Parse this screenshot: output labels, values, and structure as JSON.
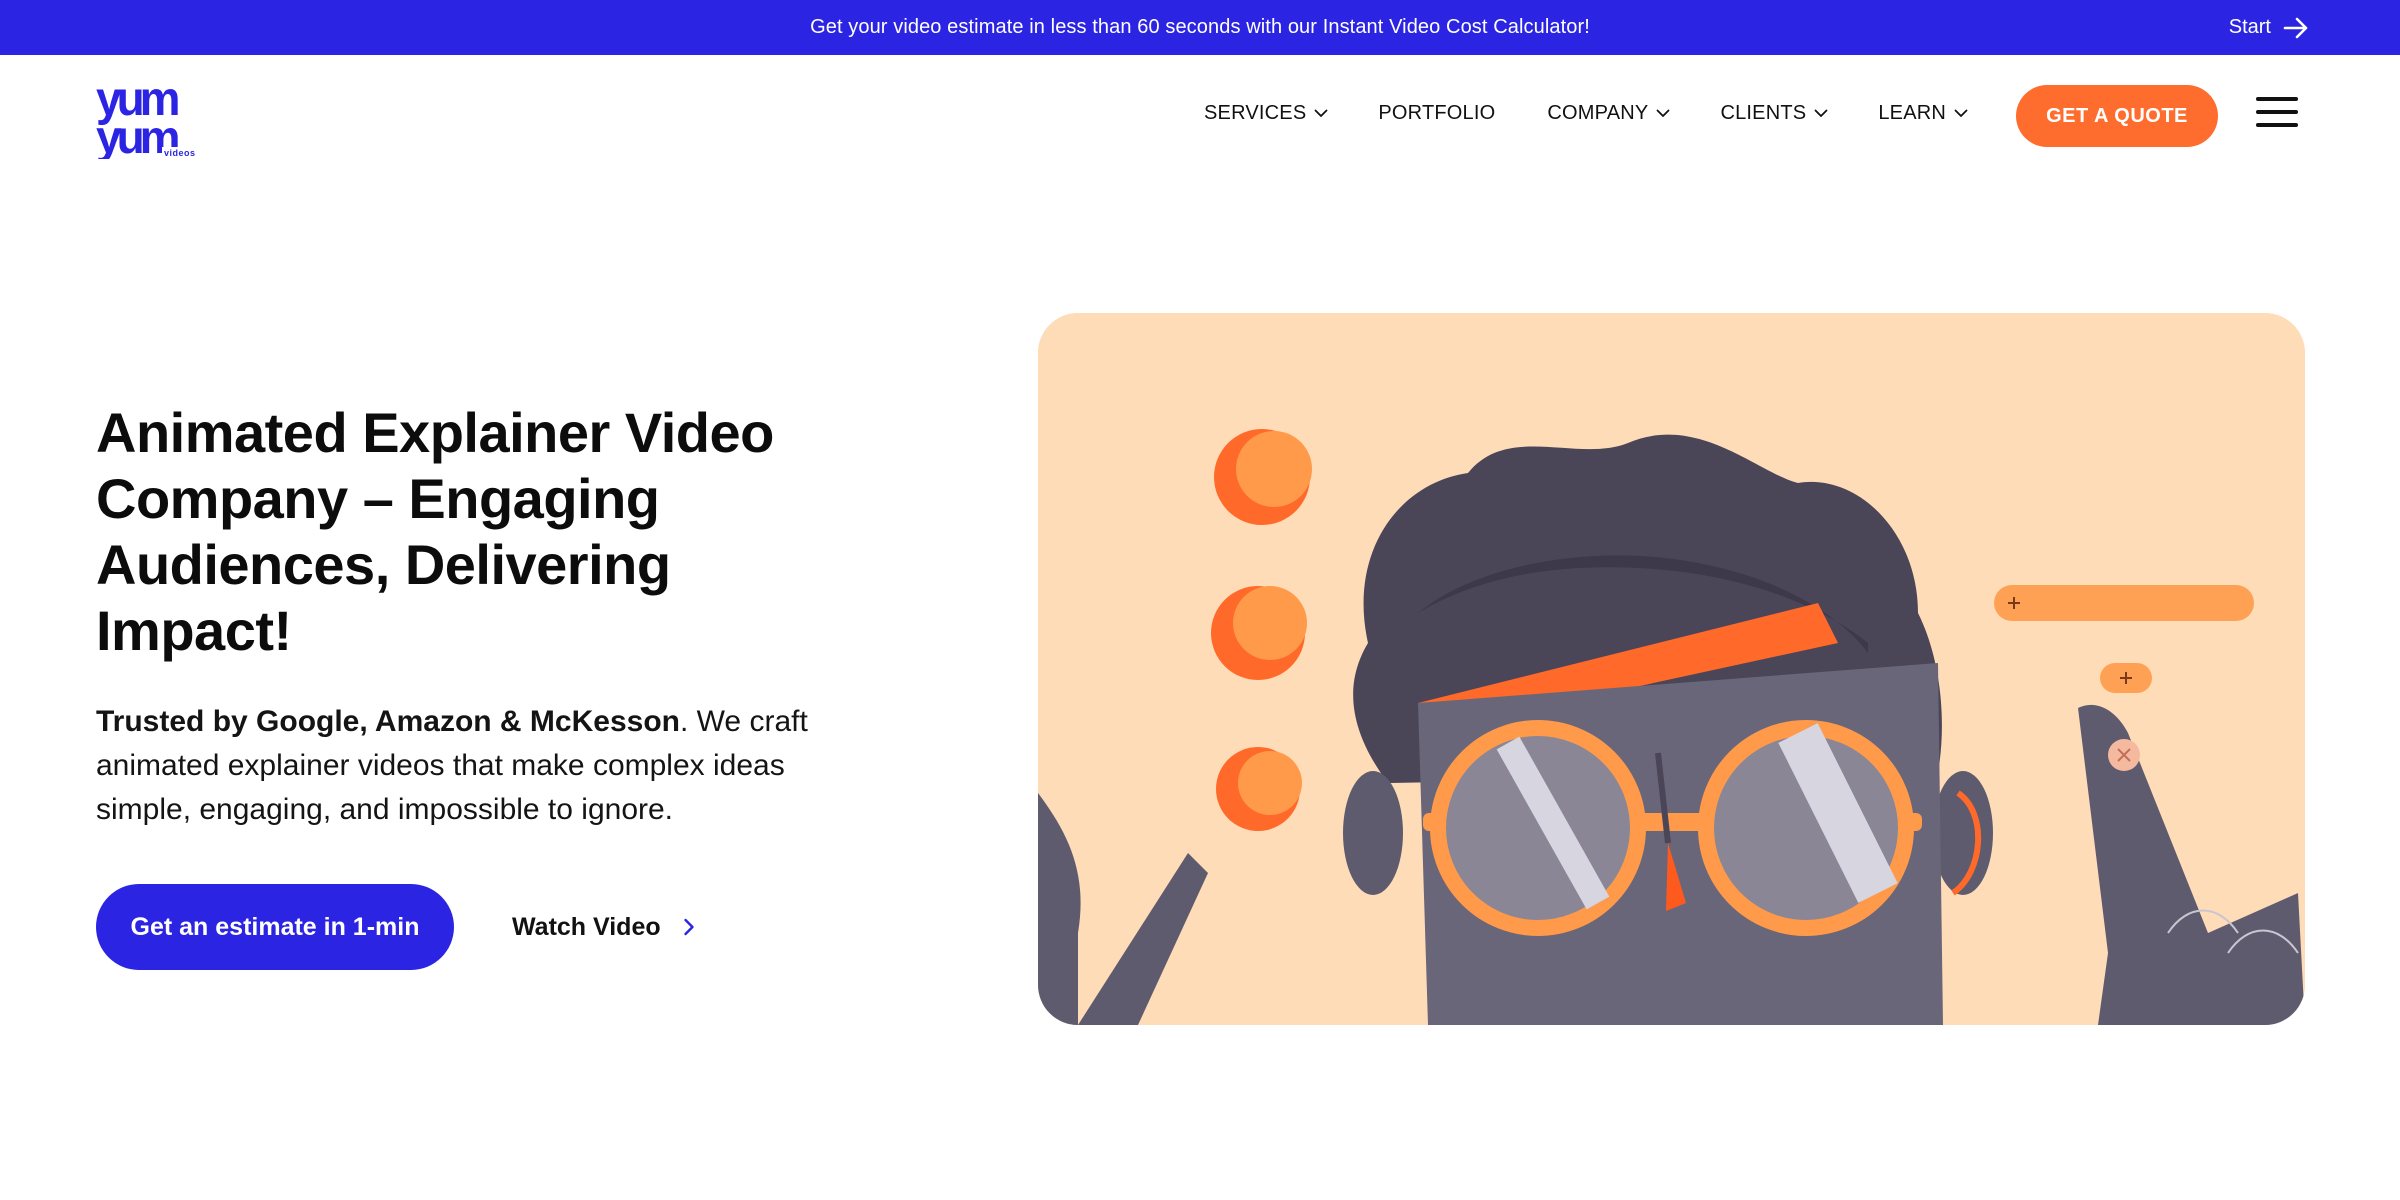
{
  "announcement": {
    "text": "Get your video estimate in less than 60 seconds with our Instant Video Cost Calculator!",
    "start_label": "Start"
  },
  "logo": {
    "alt": "yum yum videos"
  },
  "nav": {
    "items": [
      {
        "label": "SERVICES",
        "has_dropdown": true
      },
      {
        "label": "PORTFOLIO",
        "has_dropdown": false
      },
      {
        "label": "COMPANY",
        "has_dropdown": true
      },
      {
        "label": "CLIENTS",
        "has_dropdown": true
      },
      {
        "label": "LEARN",
        "has_dropdown": true
      }
    ],
    "cta_label": "GET A QUOTE"
  },
  "hero": {
    "title": "Animated Explainer Video Company – Engaging Audiences, Delivering Impact!",
    "desc_bold": "Trusted by Google, Amazon & McKesson",
    "desc_rest": ". We craft animated explainer videos that make complex ideas simple, engaging, and impossible to ignore.",
    "primary_cta": "Get an estimate in 1-min",
    "secondary_cta": "Watch Video"
  },
  "colors": {
    "brand_blue": "#2c24e3",
    "accent_orange": "#ff6d2e",
    "illustration_bg": "#ffdcb8",
    "character_gray": "#5f5b6e"
  }
}
